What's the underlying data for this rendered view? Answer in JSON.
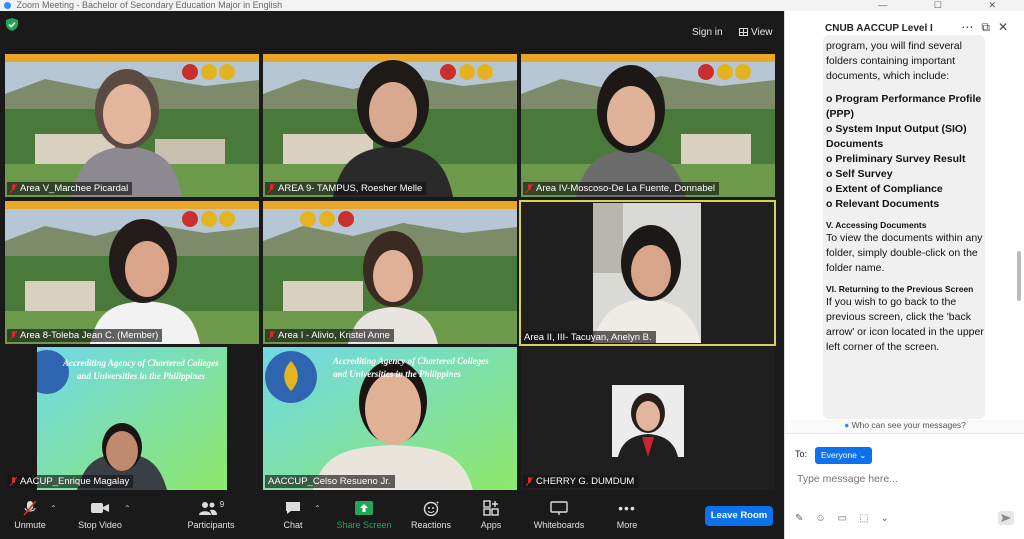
{
  "window": {
    "title": "Zoom Meeting - Bachelor of Secondary Education Major in English",
    "controls": "— ☐ ✕"
  },
  "topbar": {
    "sign_in": "Sign in",
    "view": "View"
  },
  "tiles": [
    {
      "name": "Area V_Marchee Picardal"
    },
    {
      "name": "AREA 9- TAMPUS, Roesher Melle"
    },
    {
      "name": "Area IV-Moscoso-De La Fuente, Donnabel"
    },
    {
      "name": "Area 8-Toleba Jean C. (Member)"
    },
    {
      "name": "Area I - Alivio, Kristel Anne"
    },
    {
      "name": "Area II, III- Tacuyan, Anelyn B."
    },
    {
      "name": "AACUP_Enrique Magalay"
    },
    {
      "name": "AACCUP_Celso Resueno Jr."
    },
    {
      "name": "CHERRY G. DUMDUM"
    }
  ],
  "slide_text": {
    "line1": "Accrediting Agency of Chartered Colleges",
    "line2": "and Universities in the Philippines",
    "line1b": "Accrediting Agency of Chartered Colleges",
    "line2b": "and Universities in the Philippines"
  },
  "controls": {
    "unmute": "Unmute",
    "stop_video": "Stop Video",
    "participants": "Participants",
    "participants_count": "9",
    "chat": "Chat",
    "share_screen": "Share Screen",
    "reactions": "Reactions",
    "apps": "Apps",
    "whiteboards": "Whiteboards",
    "more": "More",
    "leave": "Leave Room"
  },
  "chat": {
    "title": "CNUB AACCUP Level I",
    "lines": [
      "program, you will find several",
      "folders containing important",
      "documents, which include:"
    ],
    "items": [
      "o   Program Performance Profile (PPP)",
      "o   System Input Output (SIO) Documents",
      "o   Preliminary Survey Result",
      "o   Self Survey",
      "o   Extent of Compliance",
      "o   Relevant Documents"
    ],
    "heading5": "V.        Accessing Documents",
    "para5": "To view the documents within any folder, simply double-click on the folder name.",
    "heading6": "VI.       Returning to the Previous Screen",
    "para6": "If you wish to go back to the previous screen, click the 'back arrow' or icon located in the upper left corner of the screen.",
    "who_can_see": "Who can see your messages?",
    "to_label": "To:",
    "recipient": "Everyone",
    "placeholder": "Type message here..."
  },
  "colors": {
    "accent": "#0e72ed",
    "active_speaker": "#d9d24e",
    "share_green": "#23a559"
  }
}
